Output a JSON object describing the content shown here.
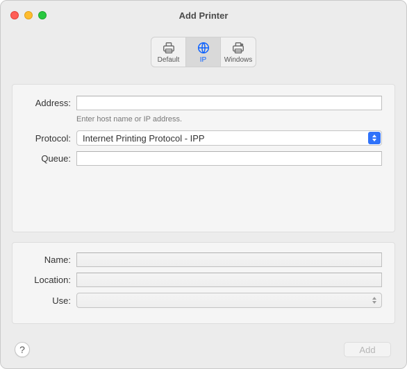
{
  "window": {
    "title": "Add Printer"
  },
  "tabs": {
    "default": "Default",
    "ip": "IP",
    "windows": "Windows"
  },
  "form": {
    "address_label": "Address:",
    "address_value": "",
    "address_hint": "Enter host name or IP address.",
    "protocol_label": "Protocol:",
    "protocol_value": "Internet Printing Protocol - IPP",
    "queue_label": "Queue:",
    "queue_value": "",
    "name_label": "Name:",
    "name_value": "",
    "location_label": "Location:",
    "location_value": "",
    "use_label": "Use:",
    "use_value": ""
  },
  "footer": {
    "help": "?",
    "add": "Add"
  }
}
